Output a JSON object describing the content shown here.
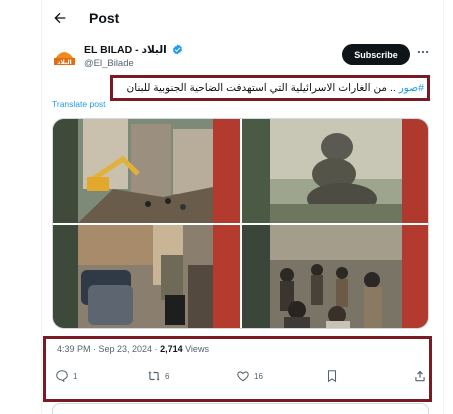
{
  "header": {
    "title": "Post"
  },
  "tweet": {
    "author_name": "EL BILAD - البلاد",
    "author_handle": "@El_Bilade",
    "subscribe_label": "Subscribe",
    "hashtag": "#صور",
    "text_body": " .. من الغارات الاسرائيلية التي استهدفت الضاحية الجنوبية للبنان",
    "translate_label": "Translate post",
    "timestamp": "4:39 PM · Sep 23, 2024 · ",
    "views_count": "2,714",
    "views_label": " Views"
  },
  "actions": {
    "replies": "1",
    "reposts": "6",
    "likes": "16"
  },
  "colors": {
    "accent": "#1d9bf0",
    "highlight_border": "#7a1a22"
  },
  "icons": [
    "back-arrow-icon",
    "verified-icon",
    "more-icon",
    "reply-icon",
    "repost-icon",
    "like-icon",
    "bookmark-icon",
    "share-icon"
  ]
}
